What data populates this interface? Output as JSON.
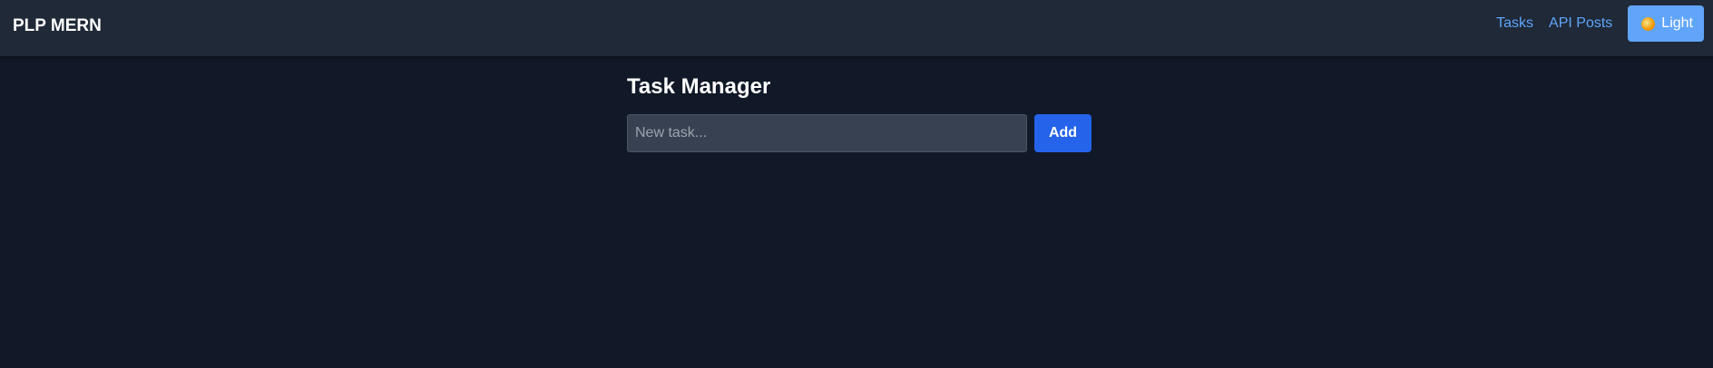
{
  "navbar": {
    "brand": "PLP MERN",
    "links": [
      {
        "label": "Tasks"
      },
      {
        "label": "API Posts"
      }
    ],
    "theme_toggle": {
      "label": "Light",
      "icon": "sun-icon"
    }
  },
  "main": {
    "title": "Task Manager",
    "task_input": {
      "value": "",
      "placeholder": "New task..."
    },
    "add_button": "Add"
  },
  "colors": {
    "background": "#111827",
    "navbar": "#1f2937",
    "link": "#60a5fa",
    "theme_button": "#60a5fa",
    "add_button": "#2563eb",
    "input_background": "#374151"
  }
}
